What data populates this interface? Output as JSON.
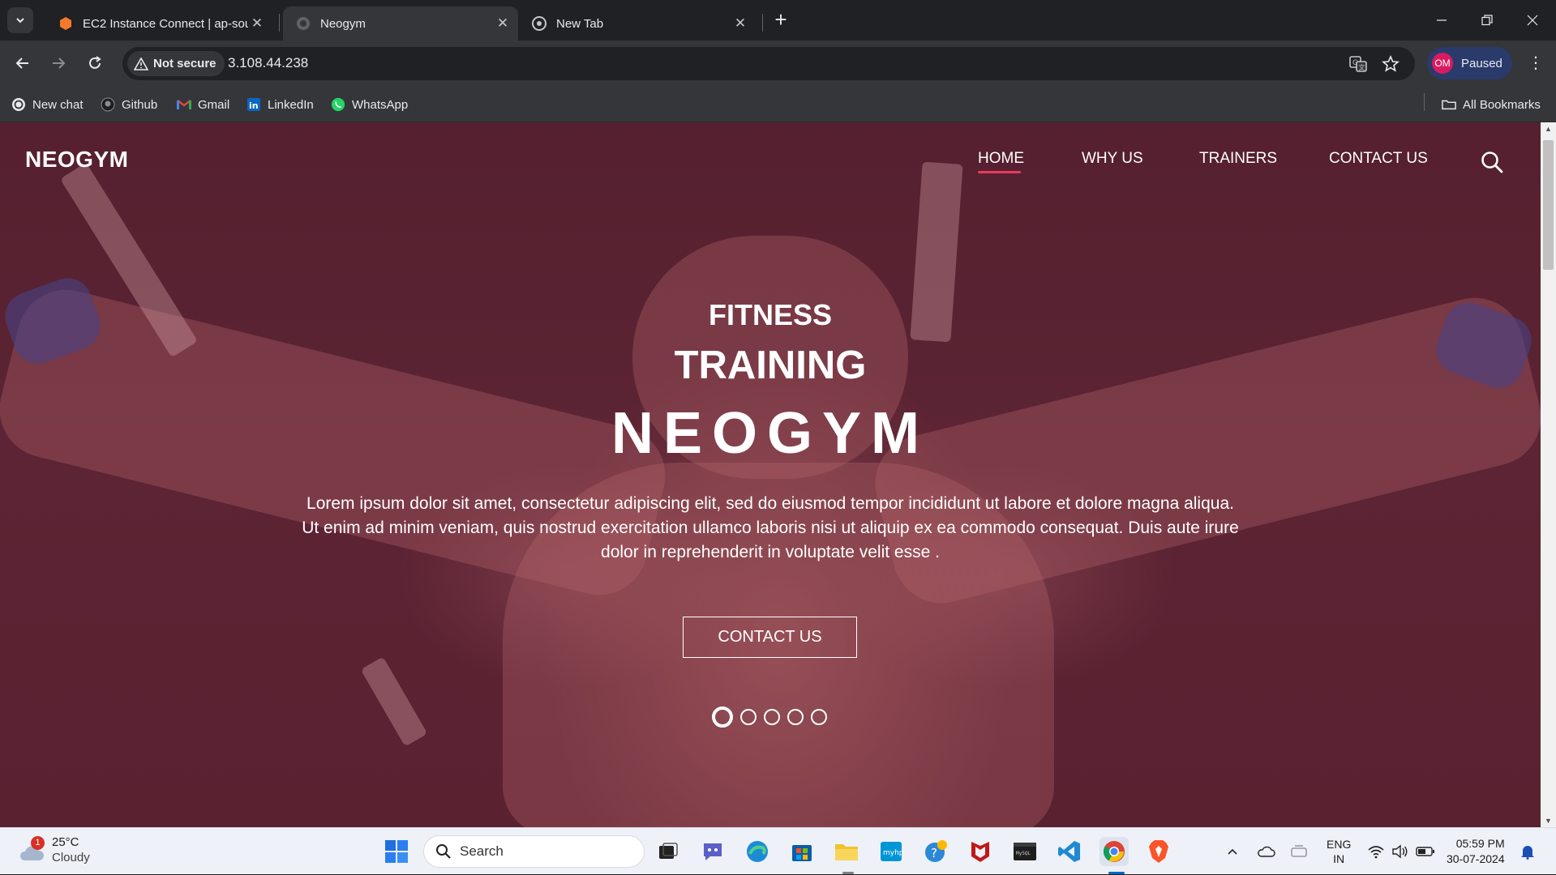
{
  "browser": {
    "tabs": [
      {
        "title": "EC2 Instance Connect | ap-south",
        "active": false
      },
      {
        "title": "Neogym",
        "active": true
      },
      {
        "title": "New Tab",
        "active": false
      }
    ],
    "security_label": "Not secure",
    "url": "3.108.44.238",
    "profile_initials": "OM",
    "profile_status": "Paused",
    "bookmarks": [
      {
        "label": "New chat",
        "icon": "chatgpt-icon"
      },
      {
        "label": "Github",
        "icon": "github-icon"
      },
      {
        "label": "Gmail",
        "icon": "gmail-icon"
      },
      {
        "label": "LinkedIn",
        "icon": "linkedin-icon"
      },
      {
        "label": "WhatsApp",
        "icon": "whatsapp-icon"
      }
    ],
    "all_bookmarks": "All Bookmarks"
  },
  "site": {
    "brand": "NEOGYM",
    "nav": [
      "HOME",
      "WHY US",
      "TRAINERS",
      "CONTACT US"
    ],
    "active_nav": "HOME",
    "hero": {
      "line1": "FITNESS",
      "line2": "TRAINING",
      "line3": "NEOGYM",
      "description": "Lorem ipsum dolor sit amet, consectetur adipiscing elit, sed do eiusmod tempor incididunt ut labore et dolore magna aliqua. Ut enim ad minim veniam, quis nostrud exercitation ullamco laboris nisi ut aliquip ex ea commodo consequat. Duis aute irure dolor in reprehenderit in voluptate velit esse .",
      "cta": "CONTACT US"
    },
    "carousel_slides": 5,
    "carousel_active_index": 0,
    "colors": {
      "overlay": "#5a2232",
      "accent": "#e93a5d"
    }
  },
  "taskbar": {
    "weather_badge": "1",
    "temperature": "25°C",
    "condition": "Cloudy",
    "search_placeholder": "Search",
    "language_line1": "ENG",
    "language_line2": "IN",
    "time": "05:59 PM",
    "date": "30-07-2024"
  }
}
